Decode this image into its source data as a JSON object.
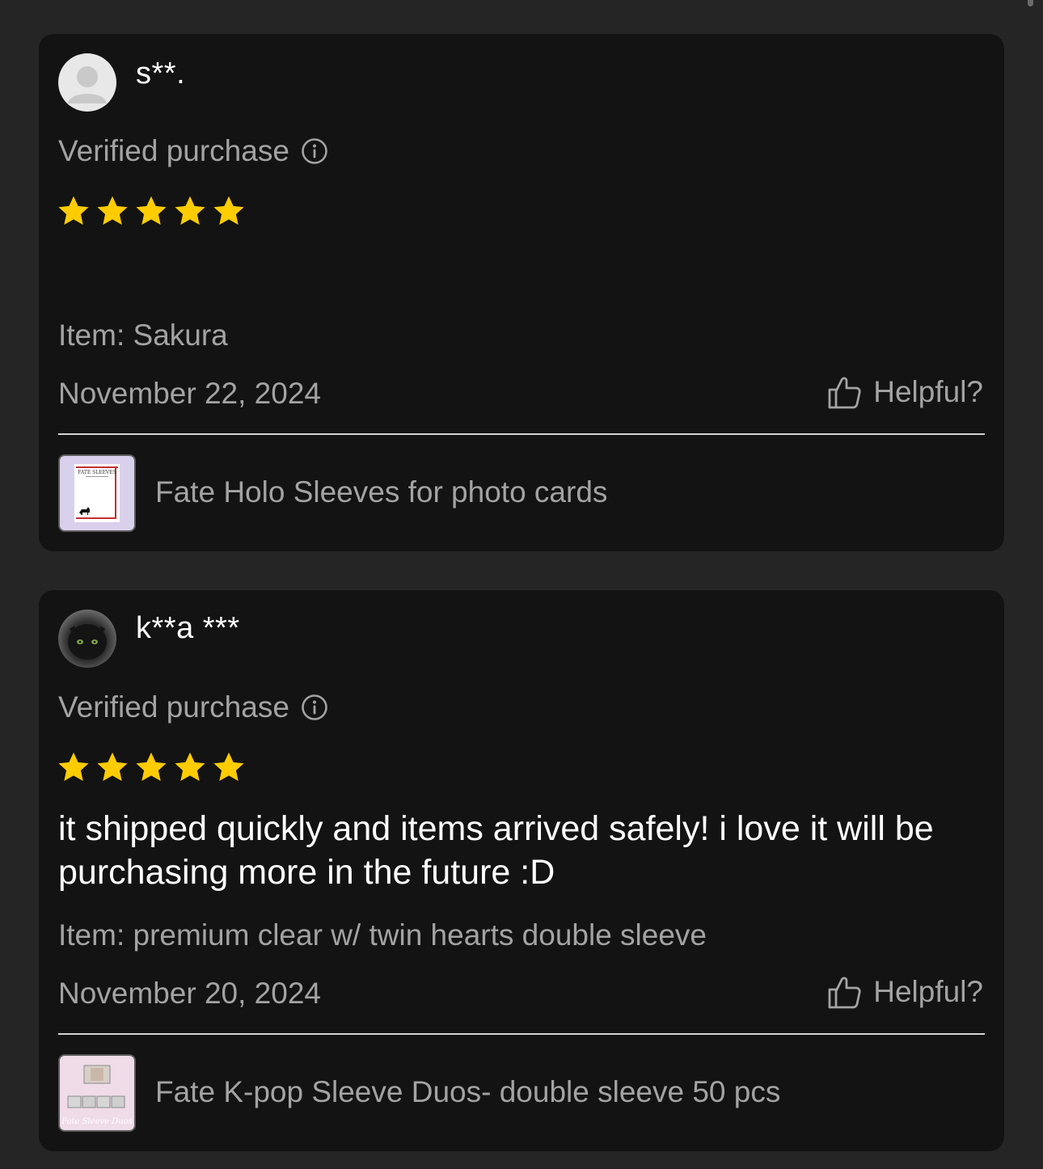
{
  "reviews": [
    {
      "username": "s**.",
      "avatar_icon": "default-user-avatar-icon",
      "verified_label": "Verified purchase",
      "rating": 5,
      "max_rating": 5,
      "text": "",
      "item": "Item: Sakura",
      "date": "November 22, 2024",
      "helpful_label": "Helpful?",
      "product_name": "Fate Holo Sleeves for photo cards",
      "product_thumb_text": "FATE SLEEVES"
    },
    {
      "username": "k**a ***",
      "avatar_icon": "user-photo-avatar",
      "verified_label": "Verified purchase",
      "rating": 5,
      "max_rating": 5,
      "text": "it shipped quickly and items arrived safely! i love it will be purchasing more in the future :D",
      "item": "Item: premium clear w/ twin hearts double sleeve",
      "date": "November 20, 2024",
      "helpful_label": "Helpful?",
      "product_name": "Fate K-pop Sleeve Duos- double sleeve 50  pcs",
      "product_thumb_text": "Fate Sleeve Duos"
    }
  ],
  "colors": {
    "page_bg": "#252525",
    "card_bg": "#131313",
    "star": "#FFCC00",
    "muted_text": "#a3a3a3",
    "primary_text": "#ffffff"
  }
}
